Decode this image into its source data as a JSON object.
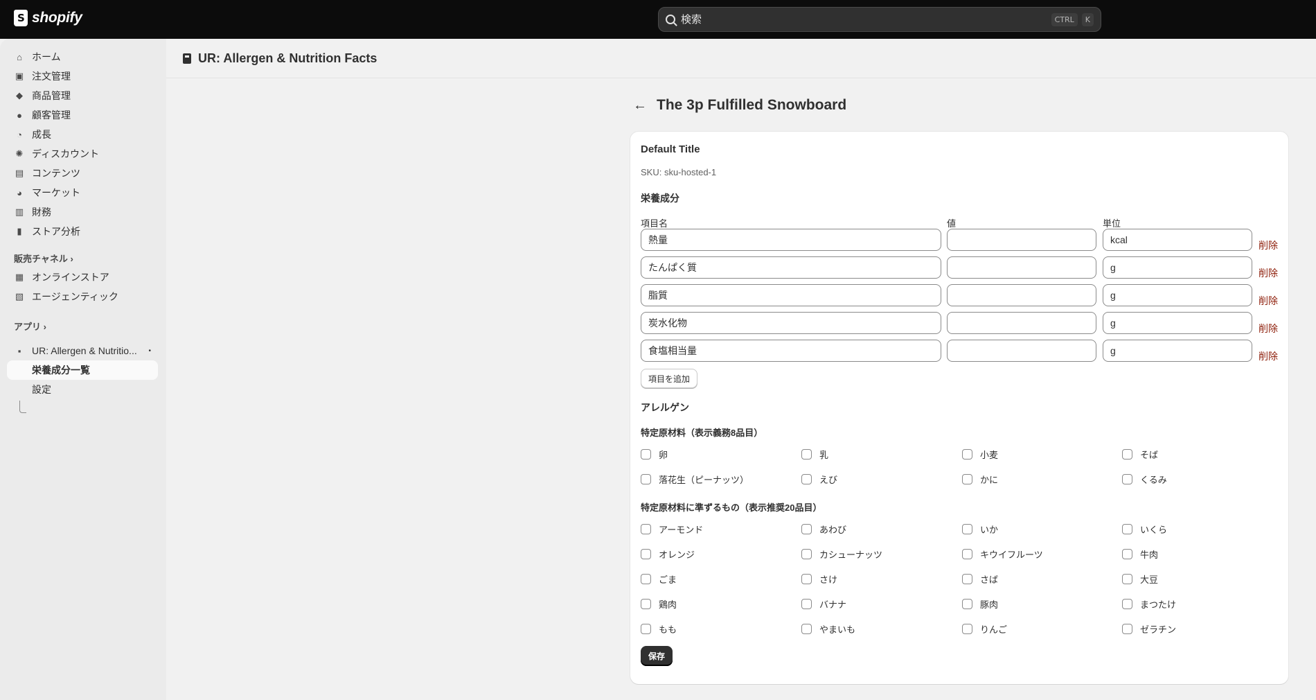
{
  "topbar": {
    "logo_text": "shopify",
    "search_placeholder": "検索",
    "shortcut_key1": "CTRL",
    "shortcut_key2": "K"
  },
  "sidebar": {
    "items": [
      {
        "label": "ホーム",
        "icon": "home-icon"
      },
      {
        "label": "注文管理",
        "icon": "inbox-icon"
      },
      {
        "label": "商品管理",
        "icon": "tag-icon"
      },
      {
        "label": "顧客管理",
        "icon": "person-icon"
      },
      {
        "label": "成長",
        "icon": "gauge-icon"
      },
      {
        "label": "ディスカウント",
        "icon": "discount-icon"
      },
      {
        "label": "コンテンツ",
        "icon": "content-icon"
      },
      {
        "label": "マーケット",
        "icon": "globe-icon"
      },
      {
        "label": "財務",
        "icon": "bank-icon"
      },
      {
        "label": "ストア分析",
        "icon": "chart-bar-icon"
      }
    ],
    "sales_channels_label": "販売チャネル",
    "channels": [
      {
        "label": "オンラインストア",
        "icon": "store-icon"
      },
      {
        "label": "エージェンティック",
        "icon": "agent-icon"
      }
    ],
    "apps_label": "アプリ",
    "app_name": "UR: Allergen & Nutritio...",
    "app_dot": "•",
    "app_subitems": [
      "栄養成分一覧",
      "設定"
    ]
  },
  "main": {
    "app_title": "UR: Allergen & Nutrition Facts",
    "page_title": "The 3p Fulfilled Snowboard",
    "variant_title": "Default Title",
    "sku": "SKU: sku-hosted-1",
    "nutrition_heading": "栄養成分",
    "col_name": "項目名",
    "col_value": "値",
    "col_unit": "単位",
    "delete_label": "削除",
    "nutrients": [
      {
        "name": "熱量",
        "value": "",
        "unit": "kcal"
      },
      {
        "name": "たんぱく質",
        "value": "",
        "unit": "g"
      },
      {
        "name": "脂質",
        "value": "",
        "unit": "g"
      },
      {
        "name": "炭水化物",
        "value": "",
        "unit": "g"
      },
      {
        "name": "食塩相当量",
        "value": "",
        "unit": "g"
      }
    ],
    "add_item_label": "項目を追加",
    "allergen_heading": "アレルゲン",
    "mandatory_heading": "特定原材料（表示義務8品目）",
    "mandatory": [
      "卵",
      "乳",
      "小麦",
      "そば",
      "落花生（ピーナッツ）",
      "えび",
      "かに",
      "くるみ"
    ],
    "recommended_heading": "特定原材料に準ずるもの（表示推奨20品目）",
    "recommended": [
      "アーモンド",
      "あわび",
      "いか",
      "いくら",
      "オレンジ",
      "カシューナッツ",
      "キウイフルーツ",
      "牛肉",
      "ごま",
      "さけ",
      "さば",
      "大豆",
      "鶏肉",
      "バナナ",
      "豚肉",
      "まつたけ",
      "もも",
      "やまいも",
      "りんご",
      "ゼラチン"
    ],
    "save_label": "保存"
  }
}
